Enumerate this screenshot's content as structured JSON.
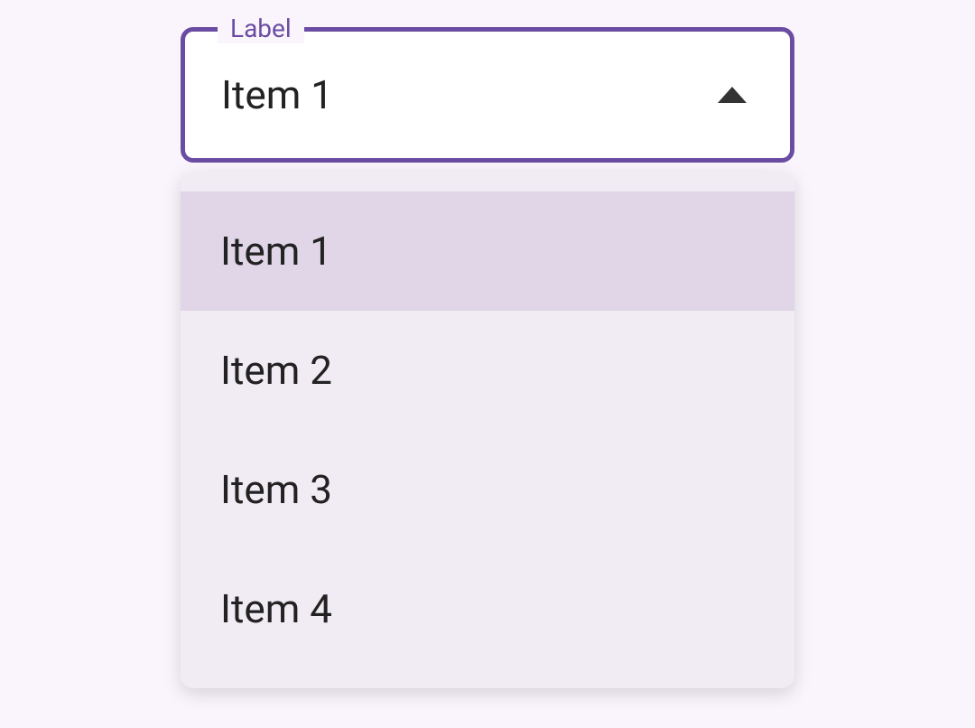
{
  "select": {
    "label": "Label",
    "value": "Item 1",
    "options": [
      {
        "label": "Item 1",
        "selected": true
      },
      {
        "label": "Item 2",
        "selected": false
      },
      {
        "label": "Item 3",
        "selected": false
      },
      {
        "label": "Item 4",
        "selected": false
      }
    ]
  }
}
